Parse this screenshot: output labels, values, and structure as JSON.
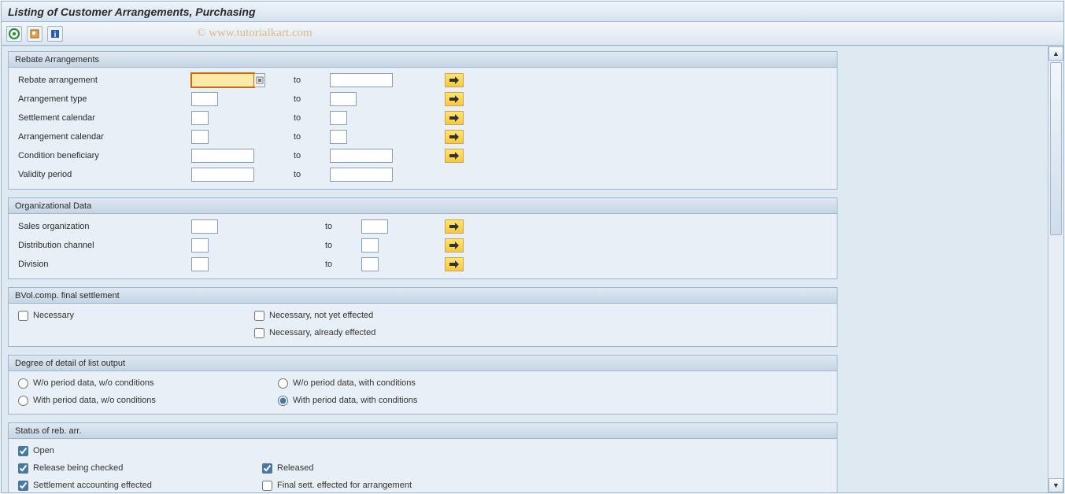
{
  "title": "Listing of Customer Arrangements, Purchasing",
  "watermark": "© www.tutorialkart.com",
  "to_label": "to",
  "groups": {
    "rebate": {
      "header": "Rebate Arrangements",
      "rows": {
        "rebate_arrangement": {
          "label": "Rebate arrangement"
        },
        "arrangement_type": {
          "label": "Arrangement type"
        },
        "settlement_calendar": {
          "label": "Settlement calendar"
        },
        "arrangement_calendar": {
          "label": "Arrangement calendar"
        },
        "condition_beneficiary": {
          "label": "Condition beneficiary"
        },
        "validity_period": {
          "label": "Validity period"
        }
      }
    },
    "org": {
      "header": "Organizational Data",
      "rows": {
        "sales_org": {
          "label": "Sales organization"
        },
        "dist_channel": {
          "label": "Distribution channel"
        },
        "division": {
          "label": "Division"
        }
      }
    },
    "bvol": {
      "header": "BVol.comp. final settlement",
      "options": {
        "necessary": "Necessary",
        "not_yet": "Necessary, not yet effected",
        "already": "Necessary, already effected"
      }
    },
    "detail": {
      "header": "Degree of detail of list output",
      "options": {
        "wo_wo": "W/o period data, w/o conditions",
        "wo_with": "W/o period data, with conditions",
        "with_wo": "With period data, w/o conditions",
        "with_with": "With period data, with conditions"
      }
    },
    "status": {
      "header": "Status of reb. arr.",
      "options": {
        "open": "Open",
        "release_check": "Release being checked",
        "released": "Released",
        "settle_acc": "Settlement accounting effected",
        "final_sett": "Final sett. effected for arrangement"
      }
    }
  }
}
